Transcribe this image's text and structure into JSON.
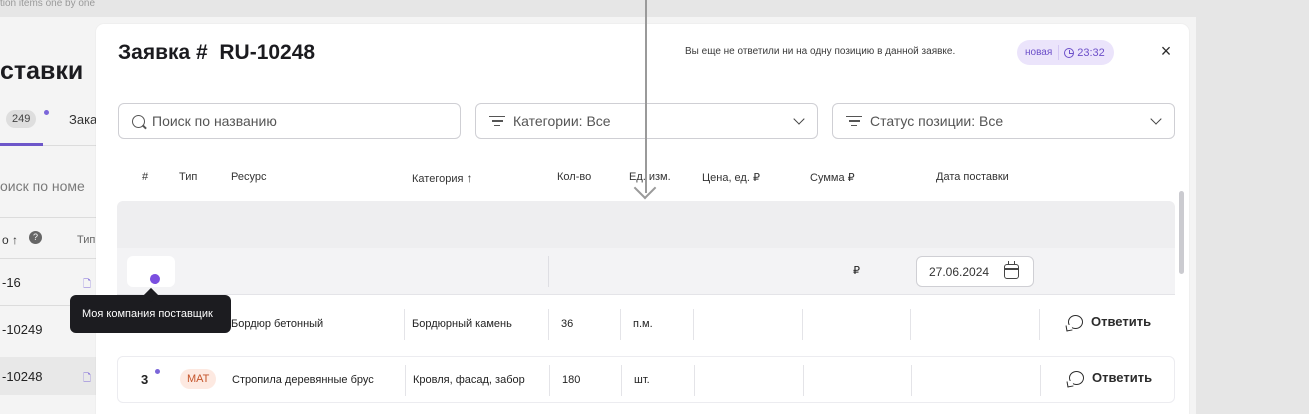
{
  "background": {
    "hint": "tion items one by one",
    "title": "ставки",
    "tab_count": "249",
    "tab2_label": "Зака",
    "search_placeholder": "оиск по номе",
    "sort_label": "о ↑",
    "info_icon": "?",
    "type_label": "Тип",
    "rows": [
      "-16",
      "-10249",
      "-10248"
    ]
  },
  "modal": {
    "title": "Заявка #  RU-10248",
    "notice": "Вы еще не ответили ни на одну позицию в данной заявке.",
    "status_label": "новая",
    "timer": "23:32",
    "close": "×"
  },
  "filters": {
    "search_placeholder": "Поиск по названию",
    "category": "Категории: Все",
    "status": "Статус позиции: Все"
  },
  "table": {
    "headers": {
      "num": "#",
      "type": "Тип",
      "resource": "Ресурс",
      "category": "Категория",
      "qty": "Кол-во",
      "unit": "Ед. изм.",
      "price": "Цена, ед. ₽",
      "sum": "Сумма ₽",
      "delivery": "Дата поставки"
    },
    "company_row": {
      "currency": "₽",
      "date": "27.06.2024"
    },
    "rows": [
      {
        "num": "",
        "type": "",
        "resource": "Бордюр бетонный",
        "category": "Бордюрный камень",
        "qty": "36",
        "unit": "п.м.",
        "action": "Ответить"
      },
      {
        "num": "3",
        "type": "МАТ",
        "resource": "Стропила деревянные брус",
        "category": "Кровля, фасад, забор",
        "qty": "180",
        "unit": "шт.",
        "action": "Ответить"
      }
    ]
  },
  "tooltip": "Моя компания поставщик"
}
